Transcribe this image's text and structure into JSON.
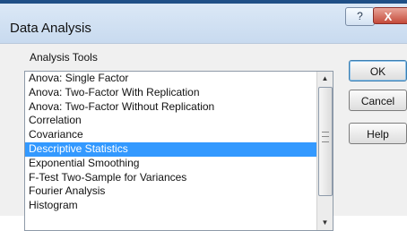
{
  "window": {
    "title": "Data Analysis"
  },
  "title_buttons": {
    "help": "?",
    "close": "X"
  },
  "group": {
    "label": "Analysis Tools"
  },
  "list": {
    "items": [
      "Anova: Single Factor",
      "Anova: Two-Factor With Replication",
      "Anova: Two-Factor Without Replication",
      "Correlation",
      "Covariance",
      "Descriptive Statistics",
      "Exponential Smoothing",
      "F-Test Two-Sample for Variances",
      "Fourier Analysis",
      "Histogram"
    ],
    "selected": "Descriptive Statistics"
  },
  "buttons": {
    "ok": "OK",
    "cancel": "Cancel",
    "help": "Help"
  },
  "colors": {
    "selection": "#3399ff",
    "title_top": "#1f4f86"
  }
}
